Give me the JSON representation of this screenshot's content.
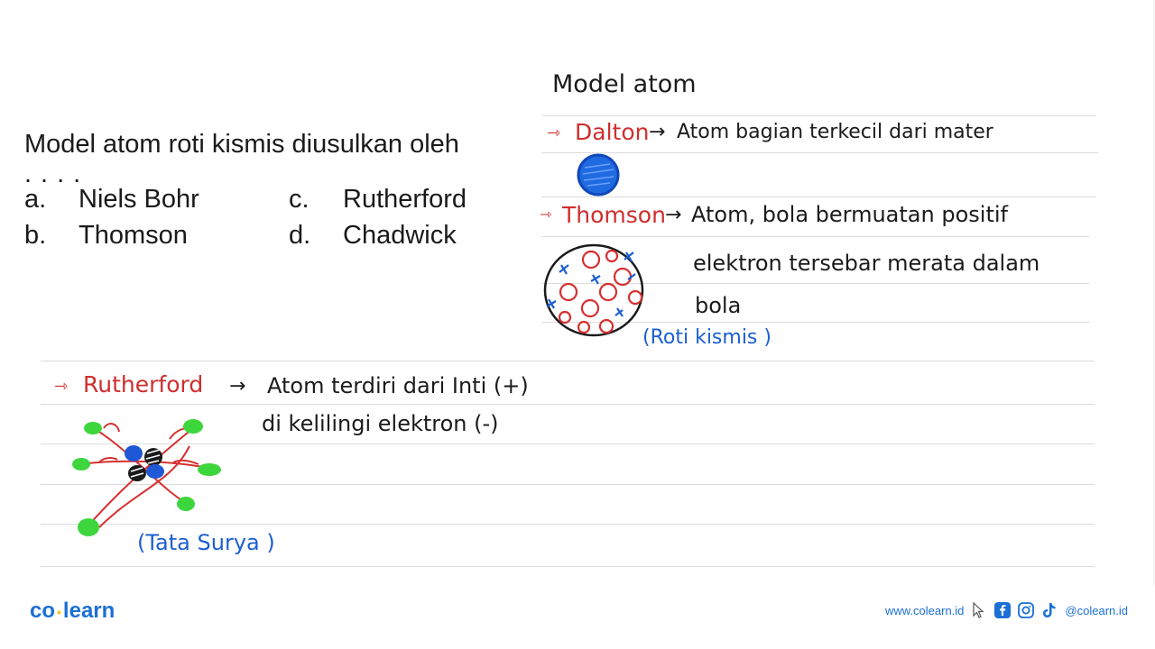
{
  "question": {
    "text": "Model atom roti kismis diusulkan oleh",
    "ellipsis": "....",
    "options": [
      {
        "letter": "a.",
        "label": "Niels Bohr"
      },
      {
        "letter": "b.",
        "label": "Thomson"
      },
      {
        "letter": "c.",
        "label": "Rutherford"
      },
      {
        "letter": "d.",
        "label": "Chadwick"
      }
    ]
  },
  "notes": {
    "title": "Model atom",
    "dalton": {
      "name": "Dalton",
      "arrow": "→",
      "desc": "Atom bagian terkecil dari mater"
    },
    "thomson": {
      "name": "Thomson",
      "arrow": "→",
      "desc_line1": "Atom, bola bermuatan positif",
      "desc_line2": "elektron tersebar merata dalam",
      "desc_line3": "bola",
      "nickname": "(Roti kismis )"
    },
    "rutherford": {
      "name": "Rutherford",
      "arrow": "→",
      "desc_line1": "Atom terdiri dari Inti (+)",
      "desc_line2": "di kelilingi elektron (-)",
      "nickname": "(Tata Surya )"
    }
  },
  "footer": {
    "logo_left": "co",
    "logo_right": "learn",
    "website": "www.colearn.id",
    "social_handle": "@colearn.id",
    "icons": [
      "cursor-icon",
      "facebook-icon",
      "instagram-icon",
      "tiktok-icon"
    ]
  },
  "colors": {
    "brand_blue": "#1b6fd6",
    "ink_red": "#cf2e2e",
    "ink_blue": "#1c5fd1",
    "ink_green": "#39d639"
  }
}
